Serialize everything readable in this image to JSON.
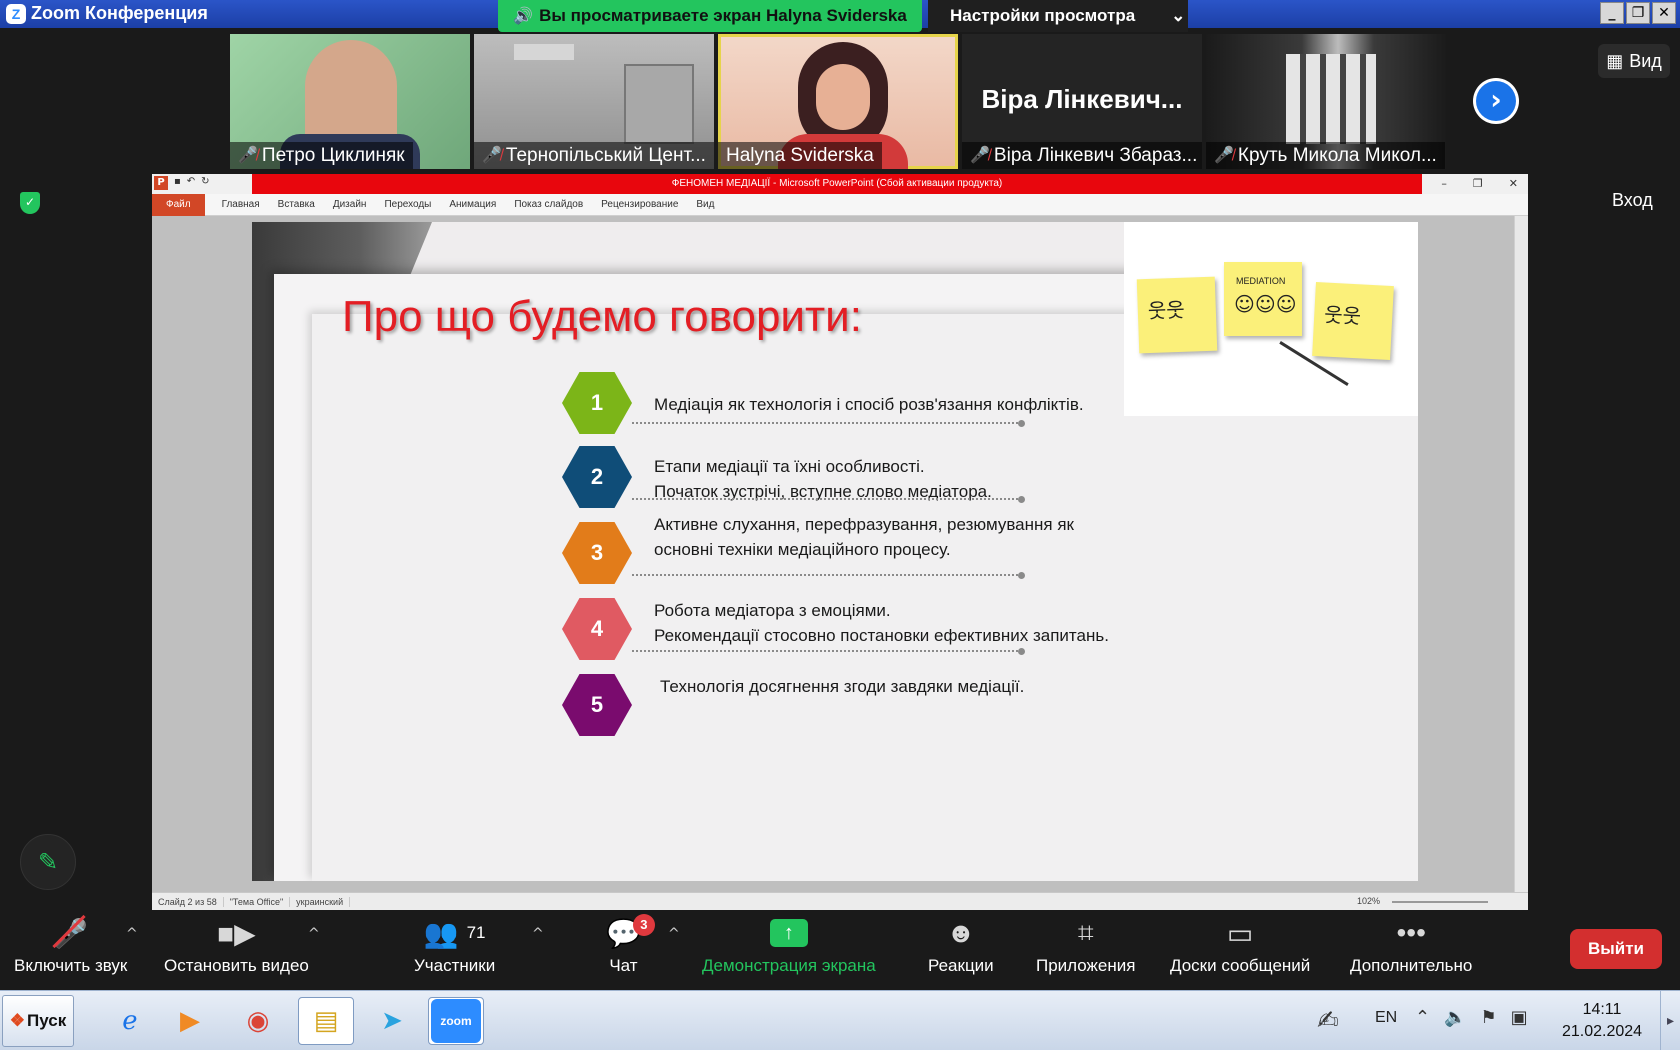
{
  "window": {
    "title": "Zoom Конференция",
    "viewing_banner": "Вы просматриваете экран Halyna Sviderska",
    "view_settings": "Настройки просмотра"
  },
  "participants": [
    {
      "name": "Петро Циклиняк",
      "muted": true
    },
    {
      "name": "Тернопільський Цент...",
      "muted": true
    },
    {
      "name": "Halyna Sviderska",
      "muted": false,
      "active": true
    },
    {
      "name": "Віра Лінкевич Збараз...",
      "muted": true,
      "big_name": "Віра Лінкевич..."
    },
    {
      "name": "Круть Микола Микол...",
      "muted": true
    }
  ],
  "side": {
    "view_button": "Вид",
    "login_button": "Вход"
  },
  "powerpoint": {
    "title": "ФЕНОМЕН МЕДІАЦІЇ  -  Microsoft PowerPoint (Сбой активации продукта)",
    "tabs": [
      "Файл",
      "Главная",
      "Вставка",
      "Дизайн",
      "Переходы",
      "Анимация",
      "Показ слайдов",
      "Рецензирование",
      "Вид"
    ],
    "status": [
      "Слайд 2 из 58",
      "\"Тема Office\"",
      "украинский"
    ],
    "zoom": "102%"
  },
  "slide": {
    "title": "Про що будемо говорити:",
    "illustration_caption": "MEDIATION",
    "items": [
      {
        "num": "1",
        "color": "#7cb518",
        "lines": [
          "Медіація як технологія і спосіб розв'язання конфліктів."
        ]
      },
      {
        "num": "2",
        "color": "#0f4d78",
        "lines": [
          "Етапи медіації та їхні особливості.",
          "Початок зустрічі, вступне слово медіатора."
        ]
      },
      {
        "num": "3",
        "color": "#e27c1a",
        "lines": [
          "Активне слухання, перефразування, резюмування як",
          "основні техніки медіаційного процесу."
        ]
      },
      {
        "num": "4",
        "color": "#e05a62",
        "lines": [
          "Робота медіатора з емоціями.",
          "Рекомендації стосовно постановки ефективних запитань."
        ]
      },
      {
        "num": "5",
        "color": "#7a0b6e",
        "lines": [
          "Технологія  досягнення згоди завдяки медіації."
        ]
      }
    ]
  },
  "toolbar": {
    "audio": "Включить звук",
    "video": "Остановить видео",
    "participants": "Участники",
    "participants_count": "71",
    "chat": "Чат",
    "chat_badge": "3",
    "share": "Демонстрация экрана",
    "reactions": "Реакции",
    "apps": "Приложения",
    "boards": "Доски сообщений",
    "more": "Дополнительно",
    "exit": "Выйти"
  },
  "taskbar": {
    "start": "Пуск",
    "zoom_label": "zoom",
    "lang": "EN",
    "time": "14:11",
    "date": "21.02.2024"
  }
}
